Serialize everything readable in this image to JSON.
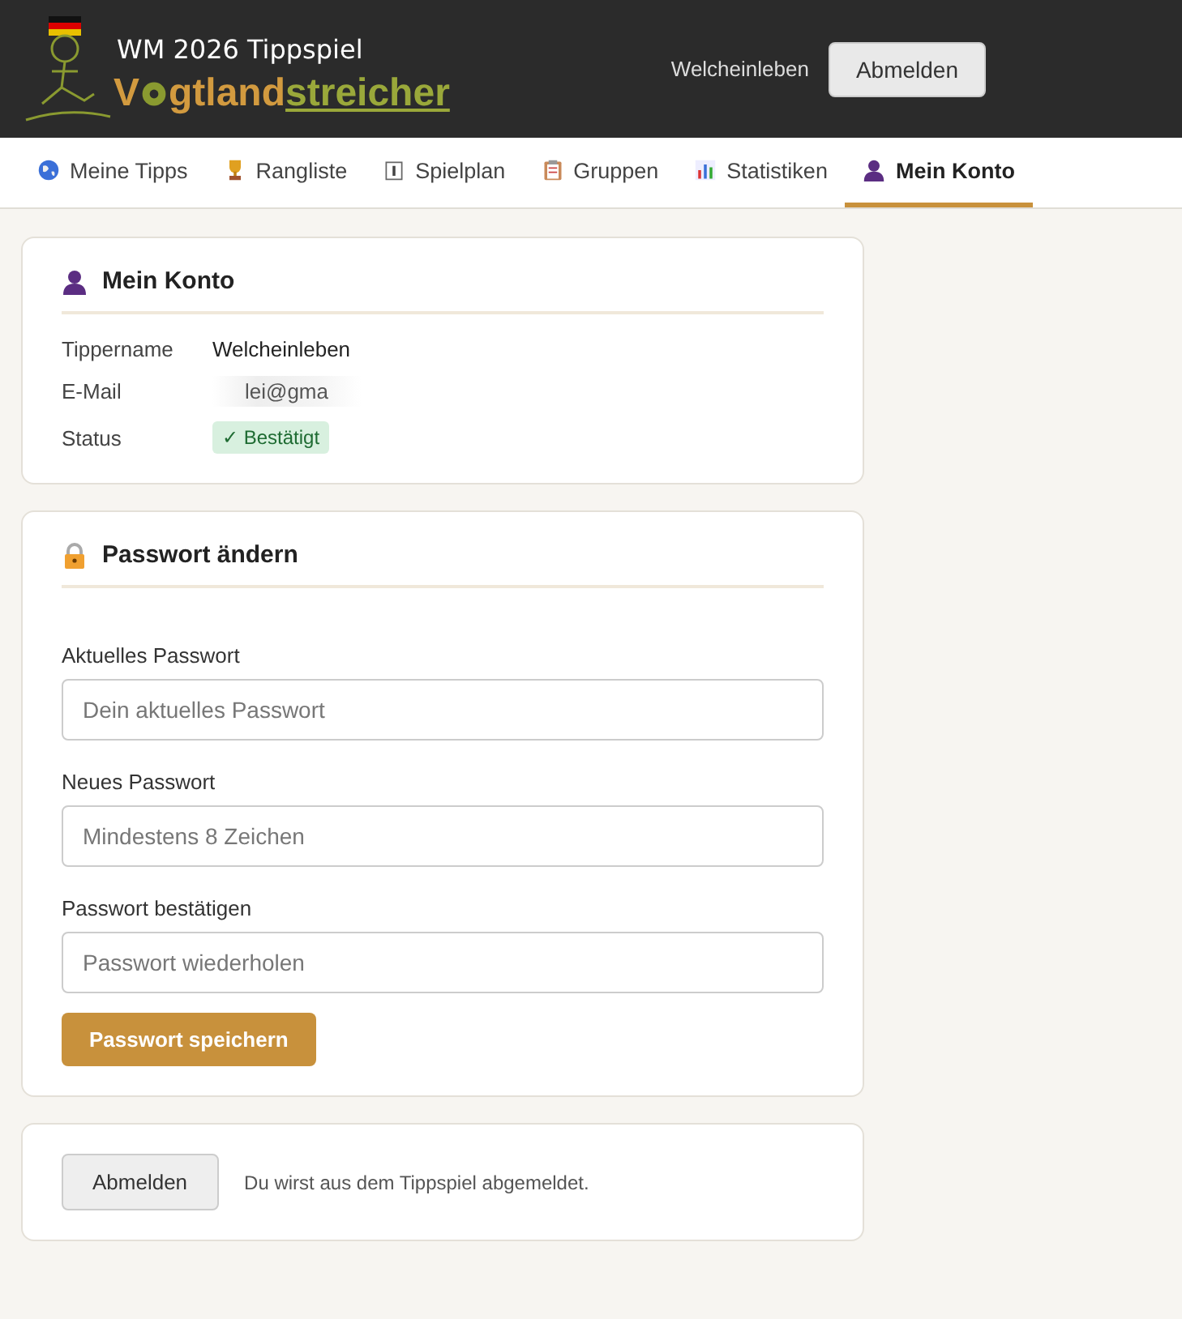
{
  "header": {
    "title": "WM 2026 Tippspiel",
    "brand_start": "V",
    "brand_mid": "gtland",
    "brand_end": "streicher",
    "username": "Welcheinleben",
    "logout_button": "Abmelden"
  },
  "tabs": [
    {
      "label": "Meine Tipps",
      "selected": false
    },
    {
      "label": "Rangliste",
      "selected": false
    },
    {
      "label": "Spielplan",
      "selected": false
    },
    {
      "label": "Gruppen",
      "selected": false
    },
    {
      "label": "Statistiken",
      "selected": false
    },
    {
      "label": "Mein Konto",
      "selected": true
    }
  ],
  "account": {
    "title": "Mein Konto",
    "rows": [
      {
        "kind": "text",
        "label": "Tippername",
        "value": "Welcheinleben"
      },
      {
        "kind": "redacted",
        "label": "E-Mail",
        "value": "lei@gma"
      },
      {
        "kind": "badge",
        "label": "Status",
        "value": "✓ Bestätigt"
      }
    ]
  },
  "password": {
    "title": "Passwort ändern",
    "fields": [
      {
        "label": "Aktuelles Passwort",
        "placeholder": "Dein aktuelles Passwort"
      },
      {
        "label": "Neues Passwort",
        "placeholder": "Mindestens 8 Zeichen"
      },
      {
        "label": "Passwort bestätigen",
        "placeholder": "Passwort wiederholen"
      }
    ],
    "save_button": "Passwort speichern"
  },
  "logout": {
    "button": "Abmelden",
    "note": "Du wirst aus dem Tippspiel abgemeldet."
  }
}
